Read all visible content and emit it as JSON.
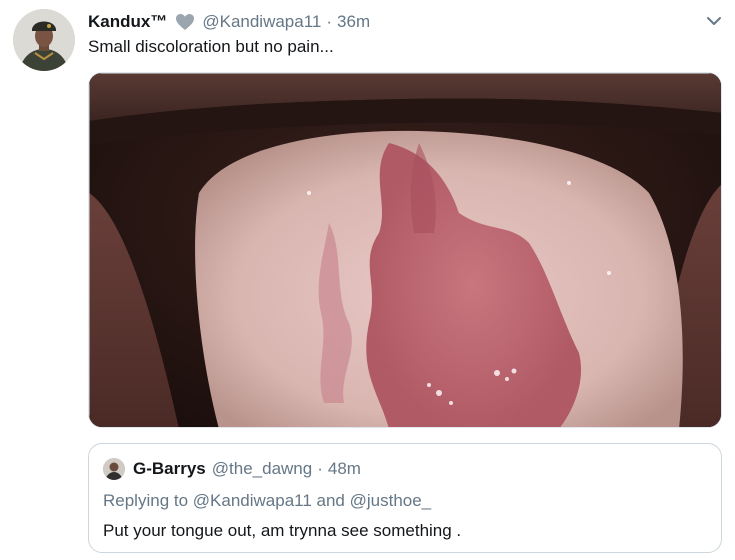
{
  "tweet": {
    "author": {
      "display_name": "Kandux™",
      "handle": "@Kandiwapa11",
      "avatar_icon": "user-avatar",
      "badge_icon": "heart-icon",
      "badge_color": "#9aa5ae"
    },
    "separator": "·",
    "time": "36m",
    "text": "Small discoloration but no pain...",
    "menu_icon": "chevron-down-icon",
    "media": {
      "type": "photo",
      "subject": "tongue"
    }
  },
  "quoted_tweet": {
    "author": {
      "display_name": "G-Barrys",
      "handle": "@the_dawng",
      "avatar_icon": "user-avatar"
    },
    "separator": "·",
    "time": "48m",
    "reply_context": "Replying to @Kandiwapa11 and @justhoe_",
    "text": "Put your tongue out, am trynna see something ."
  },
  "colors": {
    "text_primary": "#14171a",
    "text_secondary": "#657786",
    "border": "#ccd6dd"
  }
}
